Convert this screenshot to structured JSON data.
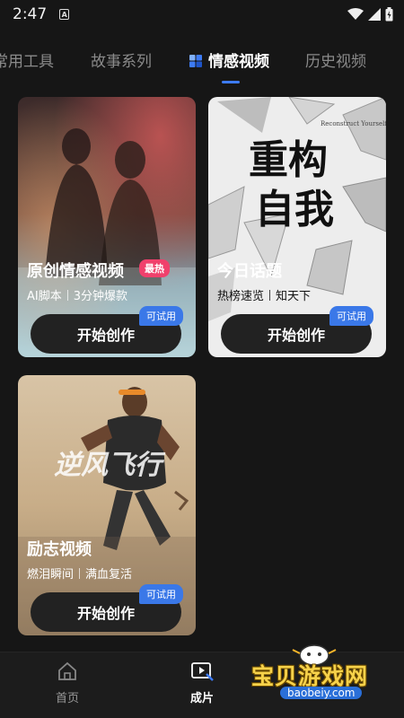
{
  "status_bar": {
    "time": "2:47",
    "a_icon": "A"
  },
  "tabs": [
    {
      "label": "常用工具"
    },
    {
      "label": "故事系列"
    },
    {
      "label": "情感视频"
    },
    {
      "label": "历史视频"
    }
  ],
  "cards": [
    {
      "title": "原创情感视频",
      "badge": "最热",
      "sub_a": "AI脚本",
      "sub_b": "3分钟爆款",
      "try_label": "可试用",
      "button": "开始创作"
    },
    {
      "title": "今日话题",
      "sub_a": "热榜速览",
      "sub_b": "知天下",
      "try_label": "可试用",
      "button": "开始创作",
      "poster_line1": "重构",
      "poster_line2": "自我",
      "poster_caption": "Reconstruct Yourself"
    },
    {
      "title": "励志视频",
      "sub_a": "燃泪瞬间",
      "sub_b": "满血复活",
      "try_label": "可试用",
      "button": "开始创作",
      "poster_text": "逆风飞行"
    }
  ],
  "bottom_nav": [
    {
      "label": "首页",
      "icon": "home-icon"
    },
    {
      "label": "成片",
      "icon": "video-play-icon"
    }
  ],
  "watermark": {
    "name": "宝贝游戏网",
    "url": "baobeiy.com"
  },
  "colors": {
    "background": "#161616",
    "accent": "#3d7bf5",
    "hot": "#f0406c",
    "watermark": "#f7d24a"
  }
}
